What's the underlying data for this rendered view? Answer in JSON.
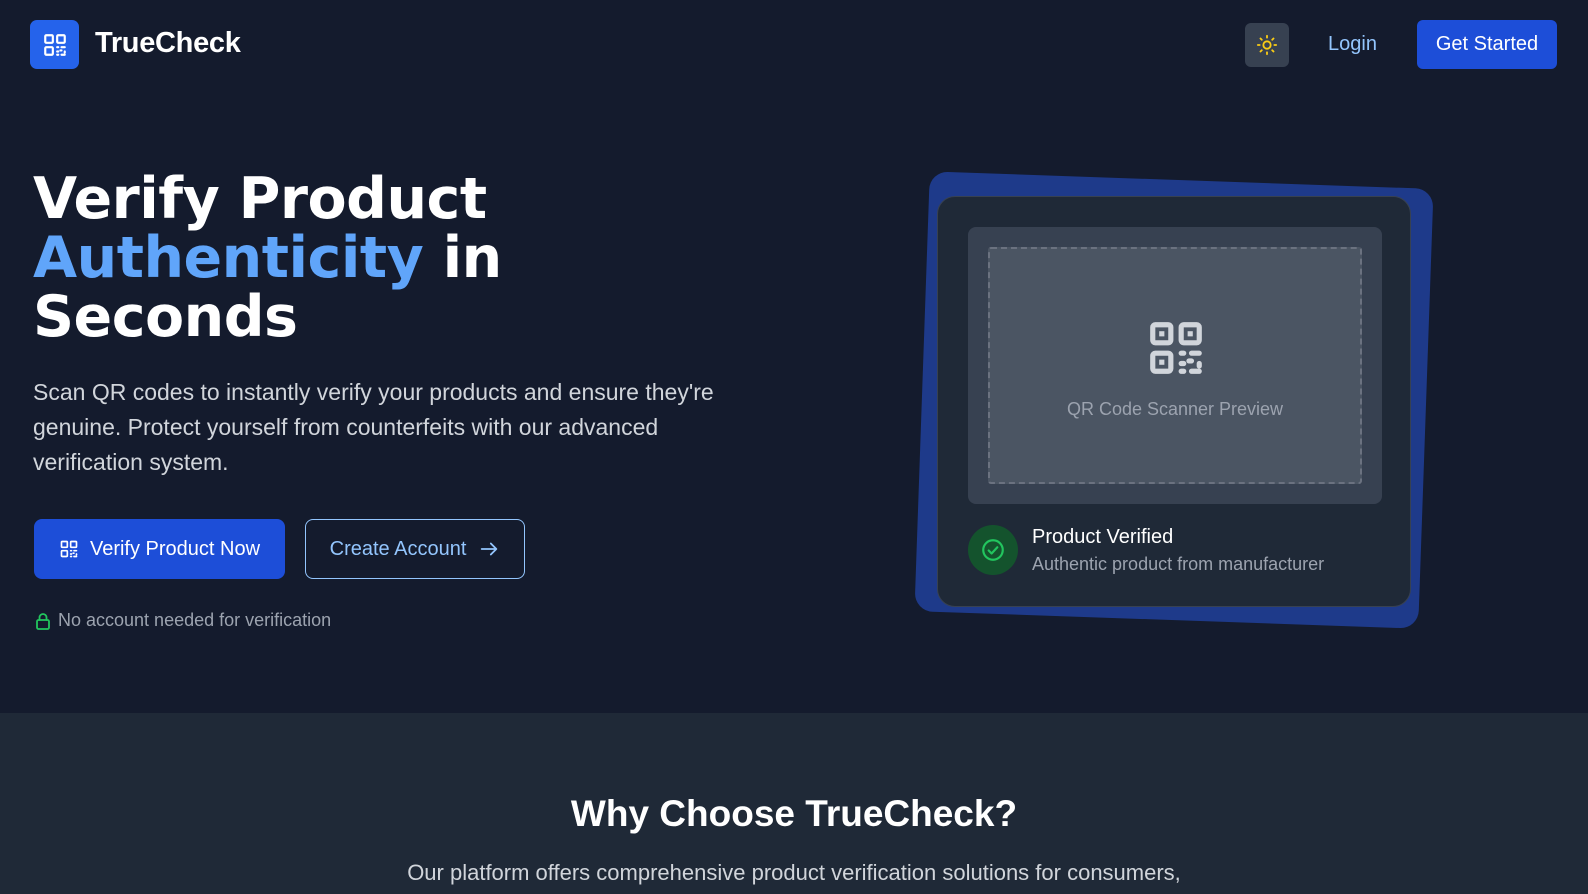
{
  "header": {
    "brand": "TrueCheck",
    "logo_icon": "qr-code-icon",
    "theme_icon": "sun-icon",
    "login_label": "Login",
    "get_started_label": "Get Started"
  },
  "hero": {
    "title_line1": "Verify Product",
    "title_accent": "Authenticity",
    "title_after_accent": " in",
    "title_line3": "Seconds",
    "description": "Scan QR codes to instantly verify your products and ensure they're genuine. Protect yourself from counterfeits with our advanced verification system.",
    "verify_button_label": "Verify Product Now",
    "create_account_label": "Create Account",
    "no_account_note": "No account needed for verification"
  },
  "preview": {
    "scanner_label": "QR Code Scanner Preview",
    "verified_title": "Product Verified",
    "verified_subtitle": "Authentic product from manufacturer"
  },
  "features": {
    "title": "Why Choose TrueCheck?",
    "subtitle": "Our platform offers comprehensive product verification solutions for consumers,"
  },
  "colors": {
    "background": "#141b2d",
    "accent": "#60a5fa",
    "primary_button": "#1d4ed8",
    "success": "#22c55e",
    "sun": "#facc15"
  }
}
